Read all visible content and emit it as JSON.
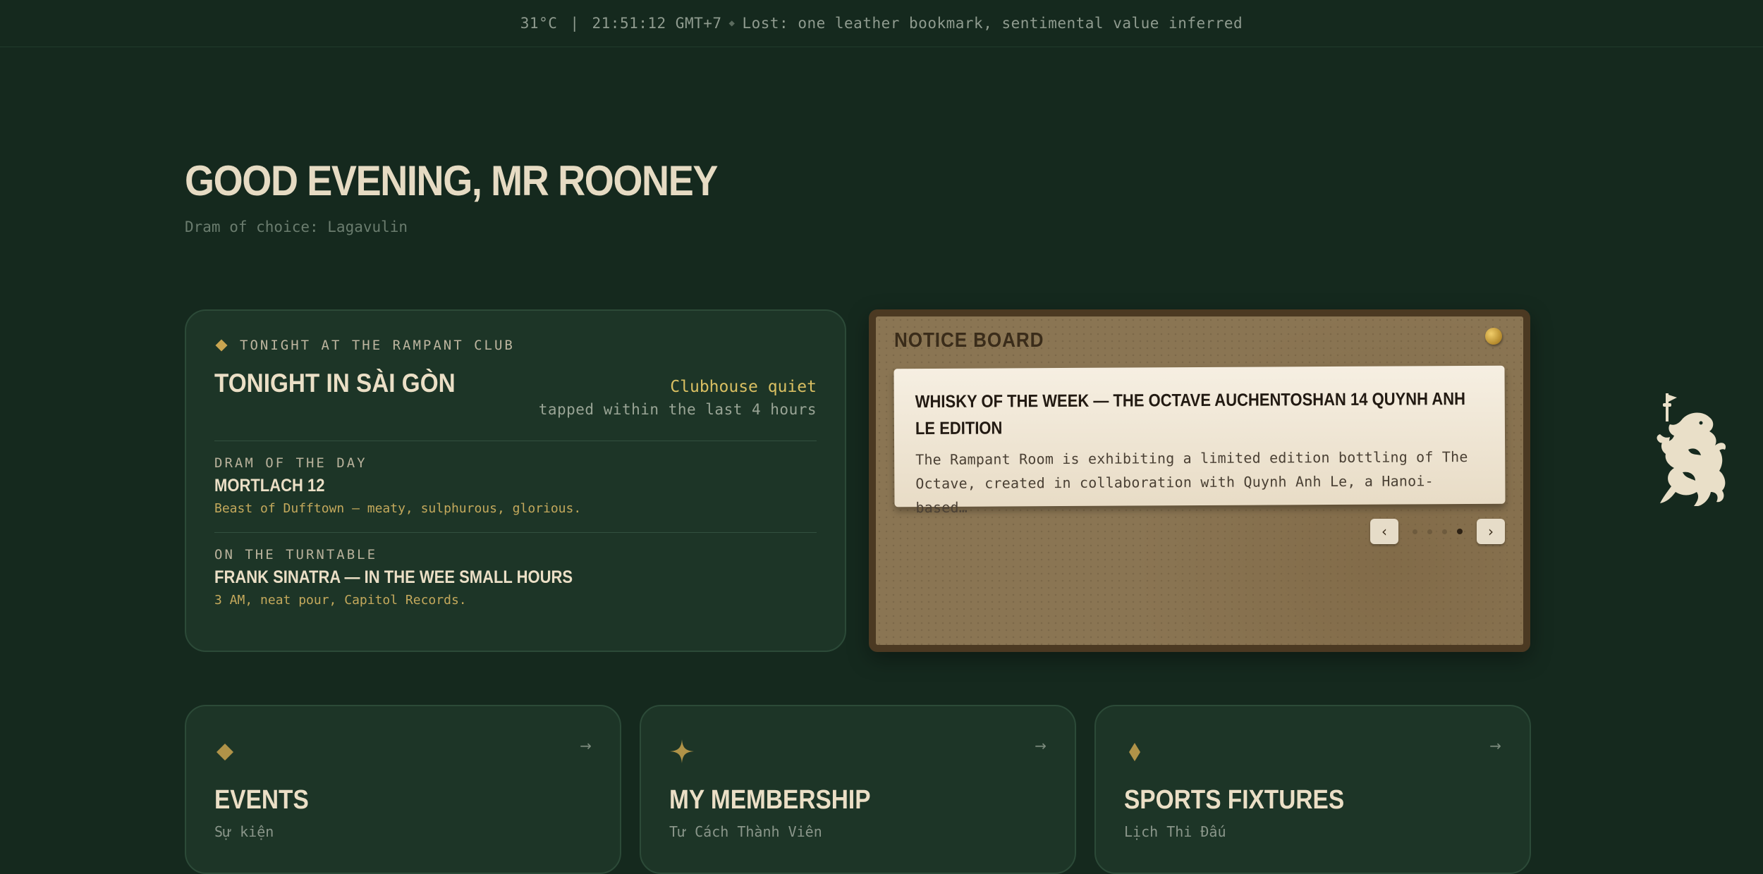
{
  "topbar": {
    "temperature": "31°C",
    "separator": "|",
    "time": "21:51:12 GMT+7",
    "lost_notice": "Lost: one leather bookmark, sentimental value inferred"
  },
  "greeting": {
    "title": "GOOD EVENING, MR ROONEY",
    "subtitle": "Dram of choice: Lagavulin"
  },
  "tonight": {
    "kicker": "TONIGHT AT THE RAMPANT CLUB",
    "city": "TONIGHT IN SÀI GÒN",
    "status": "Clubhouse quiet",
    "status_note": "tapped within the last 4 hours",
    "dram": {
      "label": "DRAM OF THE DAY",
      "title": "MORTLACH 12",
      "note": "Beast of Dufftown — meaty, sulphurous, glorious."
    },
    "turntable": {
      "label": "ON THE TURNTABLE",
      "title": "FRANK SINATRA — IN THE WEE SMALL HOURS",
      "note": "3 AM, neat pour, Capitol Records."
    }
  },
  "notice_board": {
    "title": "NOTICE BOARD",
    "card_title": "WHISKY OF THE WEEK — THE OCTAVE AUCHENTOSHAN 14 QUYNH ANH LE EDITION",
    "card_body": "The Rampant Room is exhibiting a limited edition bottling of The Octave, created in collaboration with Quynh Anh Le, a Hanoi-based…",
    "prev_label": "‹",
    "next_label": "›",
    "page_count": 4,
    "active_page": 4
  },
  "tiles": [
    {
      "title": "EVENTS",
      "subtitle": "Sự kiện",
      "arrow": "→",
      "icon": "diamond-icon"
    },
    {
      "title": "MY MEMBERSHIP",
      "subtitle": "Tư Cách Thành Viên",
      "arrow": "→",
      "icon": "star-icon"
    },
    {
      "title": "SPORTS FIXTURES",
      "subtitle": "Lịch Thi Đấu",
      "arrow": "→",
      "icon": "rhombus-icon"
    }
  ],
  "colors": {
    "background": "#15291e",
    "card": "#1d3527",
    "accent_gold": "#c9a550",
    "cream": "#ebdfc6"
  }
}
